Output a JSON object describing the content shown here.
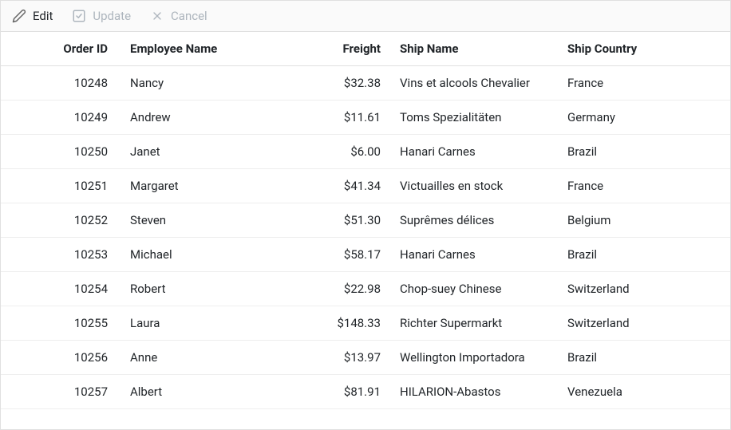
{
  "toolbar": {
    "edit": {
      "label": "Edit",
      "enabled": true
    },
    "update": {
      "label": "Update",
      "enabled": false
    },
    "cancel": {
      "label": "Cancel",
      "enabled": false
    }
  },
  "columns": {
    "orderId": "Order ID",
    "employeeName": "Employee Name",
    "freight": "Freight",
    "shipName": "Ship Name",
    "shipCountry": "Ship Country"
  },
  "rows": [
    {
      "orderId": "10248",
      "employeeName": "Nancy",
      "freight": "$32.38",
      "shipName": "Vins et alcools Chevalier",
      "shipCountry": "France"
    },
    {
      "orderId": "10249",
      "employeeName": "Andrew",
      "freight": "$11.61",
      "shipName": "Toms Spezialitäten",
      "shipCountry": "Germany"
    },
    {
      "orderId": "10250",
      "employeeName": "Janet",
      "freight": "$6.00",
      "shipName": "Hanari Carnes",
      "shipCountry": "Brazil"
    },
    {
      "orderId": "10251",
      "employeeName": "Margaret",
      "freight": "$41.34",
      "shipName": "Victuailles en stock",
      "shipCountry": "France"
    },
    {
      "orderId": "10252",
      "employeeName": "Steven",
      "freight": "$51.30",
      "shipName": "Suprêmes délices",
      "shipCountry": "Belgium"
    },
    {
      "orderId": "10253",
      "employeeName": "Michael",
      "freight": "$58.17",
      "shipName": "Hanari Carnes",
      "shipCountry": "Brazil"
    },
    {
      "orderId": "10254",
      "employeeName": "Robert",
      "freight": "$22.98",
      "shipName": "Chop-suey Chinese",
      "shipCountry": "Switzerland"
    },
    {
      "orderId": "10255",
      "employeeName": "Laura",
      "freight": "$148.33",
      "shipName": "Richter Supermarkt",
      "shipCountry": "Switzerland"
    },
    {
      "orderId": "10256",
      "employeeName": "Anne",
      "freight": "$13.97",
      "shipName": "Wellington Importadora",
      "shipCountry": "Brazil"
    },
    {
      "orderId": "10257",
      "employeeName": "Albert",
      "freight": "$81.91",
      "shipName": "HILARION-Abastos",
      "shipCountry": "Venezuela"
    }
  ]
}
